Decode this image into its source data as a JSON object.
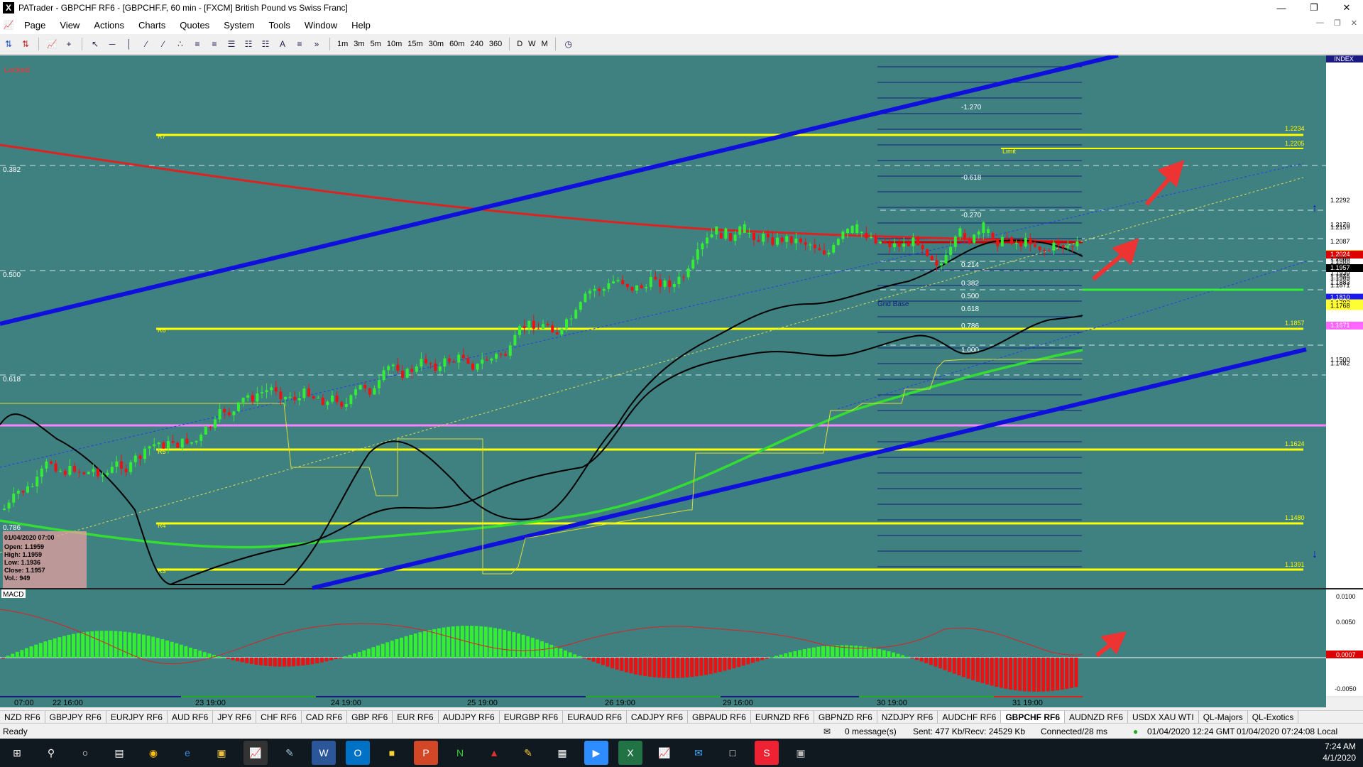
{
  "window": {
    "title": "PATrader - GBPCHF RF6 - [GBPCHF.F, 60 min - [FXCM] British Pound vs Swiss Franc]",
    "app_icon": "X"
  },
  "menu": [
    "Page",
    "View",
    "Actions",
    "Charts",
    "Quotes",
    "System",
    "Tools",
    "Window",
    "Help"
  ],
  "toolbar": {
    "timeframes": [
      "1m",
      "3m",
      "5m",
      "10m",
      "15m",
      "30m",
      "60m",
      "240",
      "360",
      "D",
      "W",
      "M"
    ]
  },
  "chart": {
    "locked_label": "Locked",
    "index_label": "INDEX",
    "ohlc_box": {
      "date": "01/04/2020 07:00",
      "open": "Open: 1.1959",
      "high": "High: 1.1959",
      "low": "Low: 1.1936",
      "close": "Close: 1.1957",
      "vol": "Vol.: 949"
    },
    "fib_left_labels": [
      "0.382",
      "0.500",
      "0.618",
      "0.786"
    ],
    "pivot_labels": [
      "R7",
      "R6",
      "R5",
      "R4",
      "R3"
    ],
    "pivot_values_right": [
      "1.2234",
      "1.1857",
      "1.1624",
      "1.1480",
      "1.1391"
    ],
    "grid_labels": [
      "-1.270",
      "-0.618",
      "-0.270",
      "0.214",
      "0.382",
      "0.500",
      "0.618",
      "0.786",
      "1.000"
    ],
    "grid_base_label": "Grid Base",
    "limit_label": "Limit",
    "limit_value": "1.2205",
    "price_axis": [
      "1.2292",
      "1.2170",
      "1.2159",
      "1.2087",
      "1.2027",
      "1.2024",
      "1.2000",
      "1.1988",
      "1.1969",
      "1.1957",
      "1.1930",
      "1.1915",
      "1.1905",
      "1.1883",
      "1.1871",
      "1.1810",
      "1.1782",
      "1.1768",
      "1.1671",
      "1.1500",
      "1.1482"
    ],
    "x_axis": [
      "07:00",
      "22 16:00",
      "23 19:00",
      "24 19:00",
      "25 19:00",
      "26 19:00",
      "29 16:00",
      "30 19:00",
      "31 19:00"
    ],
    "macd_label": "MACD",
    "macd_axis": [
      "0.0100",
      "0.0050",
      "0.0007",
      "-0.0050"
    ]
  },
  "tabs": [
    "NZD RF6",
    "GBPJPY RF6",
    "EURJPY RF6",
    "AUD RF6",
    "JPY RF6",
    "CHF RF6",
    "CAD RF6",
    "GBP RF6",
    "EUR RF6",
    "AUDJPY RF6",
    "EURGBP RF6",
    "EURAUD RF6",
    "CADJPY RF6",
    "GBPAUD RF6",
    "EURNZD RF6",
    "GBPNZD RF6",
    "NZDJPY RF6",
    "AUDCHF RF6",
    "GBPCHF RF6",
    "AUDNZD RF6",
    "USDX XAU WTI",
    "QL-Majors",
    "QL-Exotics"
  ],
  "active_tab": "GBPCHF RF6",
  "status": {
    "ready": "Ready",
    "messages": "0 message(s)",
    "traffic": "Sent: 477 Kb/Recv: 24529 Kb",
    "connected": "Connected/28 ms",
    "gmt": "01/04/2020 12:24 GMT",
    "local": "01/04/2020 07:24:08 Local"
  },
  "taskbar": {
    "time": "7:24 AM",
    "date": "4/1/2020"
  },
  "colors": {
    "chart_bg": "#3f8080",
    "bull": "#33ee33",
    "bear": "#ee1111",
    "trend_blue": "#1010dd",
    "pivot_yellow": "#ffff00",
    "ma_red": "#dd2222",
    "magenta": "#ff80ff"
  }
}
